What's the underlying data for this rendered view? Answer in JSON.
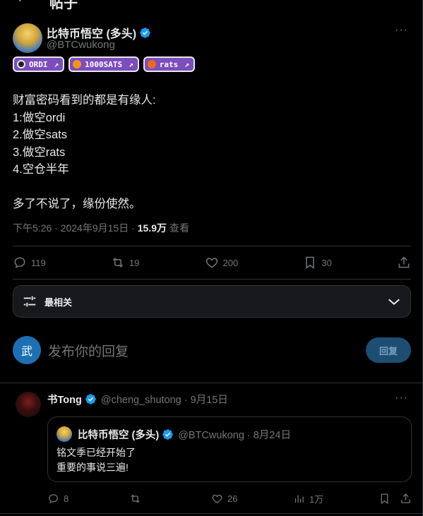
{
  "header": {
    "back": "←",
    "title": "帖子"
  },
  "tweet": {
    "author": {
      "name": "比特币悟空 (多头)",
      "handle": "@BTCwukong"
    },
    "more": "···",
    "chips": [
      {
        "label": "ORDI",
        "coin_color": "#e7e9ea"
      },
      {
        "label": "1000SATS",
        "coin_color": "#f7931a"
      },
      {
        "label": "rats",
        "coin_color": "#f06a1a"
      }
    ],
    "chip_arrow": "↗",
    "text_lines": [
      "财富密码看到的都是有缘人:",
      "1:做空ordi",
      "2.做空sats",
      "3.做空rats",
      "4.空仓半年",
      "",
      "多了不说了，缘份使然。"
    ],
    "time": "下午5:26 · 2024年9月15日 ·",
    "views": "15.9万",
    "views_label": "查看",
    "stats": {
      "replies": "119",
      "retweets": "19",
      "likes": "200",
      "bookmarks": "30"
    }
  },
  "sort": {
    "label": "最相关"
  },
  "compose": {
    "avatar_letter": "武",
    "placeholder": "发布你的回复",
    "button": "回复"
  },
  "reply": {
    "name": "书Tong",
    "handle": "@cheng_shutong · 9月15日",
    "more": "···",
    "quote": {
      "name": "比特币悟空 (多头)",
      "handle": "@BTCwukong · 8月24日",
      "line1": "铭文季已经开始了",
      "line2": "重要的事说三遍!"
    },
    "stats": {
      "replies": "8",
      "likes": "26",
      "views": "1万"
    }
  },
  "colors": {
    "bg": "#000000",
    "text": "#e7e9ea",
    "muted": "#71767b",
    "border": "#2f3336",
    "verified": "#1d9bf0",
    "chip": "#7c4dbd"
  }
}
